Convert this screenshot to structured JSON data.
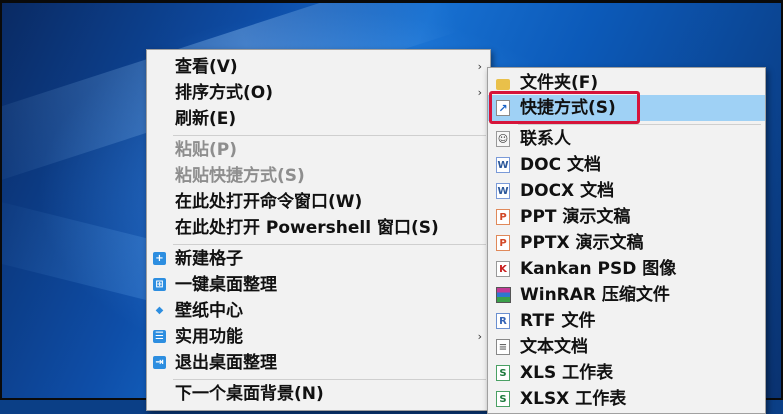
{
  "main_menu": {
    "items": [
      {
        "label": "查看(V)",
        "submenu": true,
        "disabled": false,
        "icon": ""
      },
      {
        "label": "排序方式(O)",
        "submenu": true,
        "disabled": false,
        "icon": ""
      },
      {
        "label": "刷新(E)",
        "submenu": false,
        "disabled": false,
        "icon": ""
      },
      {
        "label": "粘贴(P)",
        "submenu": false,
        "disabled": true,
        "icon": ""
      },
      {
        "label": "粘贴快捷方式(S)",
        "submenu": false,
        "disabled": true,
        "icon": ""
      },
      {
        "label": "在此处打开命令窗口(W)",
        "submenu": false,
        "disabled": false,
        "icon": ""
      },
      {
        "label": "在此处打开 Powershell 窗口(S)",
        "submenu": false,
        "disabled": false,
        "icon": ""
      },
      {
        "label": "新建格子",
        "submenu": false,
        "disabled": false,
        "icon": "add-box-icon"
      },
      {
        "label": "一键桌面整理",
        "submenu": false,
        "disabled": false,
        "icon": "grid-icon"
      },
      {
        "label": "壁纸中心",
        "submenu": false,
        "disabled": false,
        "icon": "wallpaper-icon"
      },
      {
        "label": "实用功能",
        "submenu": true,
        "disabled": false,
        "icon": "list-icon"
      },
      {
        "label": "退出桌面整理",
        "submenu": false,
        "disabled": false,
        "icon": "exit-icon"
      },
      {
        "label": "下一个桌面背景(N)",
        "submenu": false,
        "disabled": false,
        "icon": ""
      }
    ]
  },
  "new_submenu": {
    "items": [
      {
        "label": "文件夹(F)",
        "icon": "folder-icon"
      },
      {
        "label": "快捷方式(S)",
        "icon": "shortcut-icon",
        "highlighted": true
      },
      {
        "label": "联系人",
        "icon": "contact-icon"
      },
      {
        "label": "DOC 文档",
        "icon": "doc-icon"
      },
      {
        "label": "DOCX 文档",
        "icon": "docx-icon"
      },
      {
        "label": "PPT 演示文稿",
        "icon": "ppt-icon"
      },
      {
        "label": "PPTX 演示文稿",
        "icon": "pptx-icon"
      },
      {
        "label": "Kankan PSD 图像",
        "icon": "kankan-psd-icon"
      },
      {
        "label": "WinRAR 压缩文件",
        "icon": "winrar-icon"
      },
      {
        "label": "RTF 文件",
        "icon": "rtf-icon"
      },
      {
        "label": "文本文档",
        "icon": "text-doc-icon"
      },
      {
        "label": "XLS 工作表",
        "icon": "xls-icon"
      },
      {
        "label": "XLSX 工作表",
        "icon": "xlsx-icon"
      }
    ]
  },
  "colors": {
    "highlight": "#9fd1f5",
    "annotation_box": "#d6143a",
    "menu_bg": "#f2f2f2"
  },
  "glyphs": {
    "submenu_arrow": "›",
    "add_box": "+",
    "grid": "⊞",
    "wallpaper": "◆",
    "list": "☰",
    "exit": "⇥",
    "shortcut": "↗",
    "doc": "W",
    "ppt": "P",
    "kankan": "K",
    "rtf": "R",
    "txt": "≡",
    "xls": "S",
    "contact": "☺"
  }
}
